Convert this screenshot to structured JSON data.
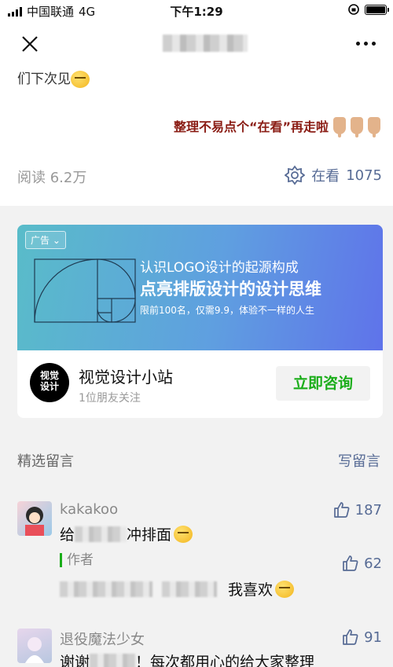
{
  "status_bar": {
    "carrier": "中国联通",
    "network": "4G",
    "time": "下午1:29"
  },
  "article": {
    "tail_text": "们下次见",
    "cta_text": "整理不易点个“在看”再走啦",
    "reads": "阅读 6.2万",
    "watching_label": "在看",
    "watching_count": "1075"
  },
  "ad": {
    "tag": "广告",
    "line1": "认识LOGO设计的起源构成",
    "line2": "点亮排版设计的设计思维",
    "line3": "限前100名，仅需9.9，体验不一样的人生",
    "brand_name": "视觉设计小站",
    "brand_logo_text_1": "视觉",
    "brand_logo_text_2": "设计",
    "brand_sub": "1位朋友关注",
    "button": "立即咨询"
  },
  "comments": {
    "title": "精选留言",
    "write": "写留言",
    "items": [
      {
        "user": "kakakoo",
        "likes": "187",
        "prefix": "给",
        "suffix": "冲排面"
      },
      {
        "user": "作者",
        "likes": "62",
        "suffix": "我喜欢",
        "is_author_reply": true
      },
      {
        "user": "退役魔法少女",
        "likes": "91",
        "prefix": "谢谢",
        "suffix": "！每次都用心的给大家整理"
      }
    ]
  },
  "colors": {
    "link": "#576b95",
    "green": "#1aad19",
    "cta": "#8a1c14"
  }
}
